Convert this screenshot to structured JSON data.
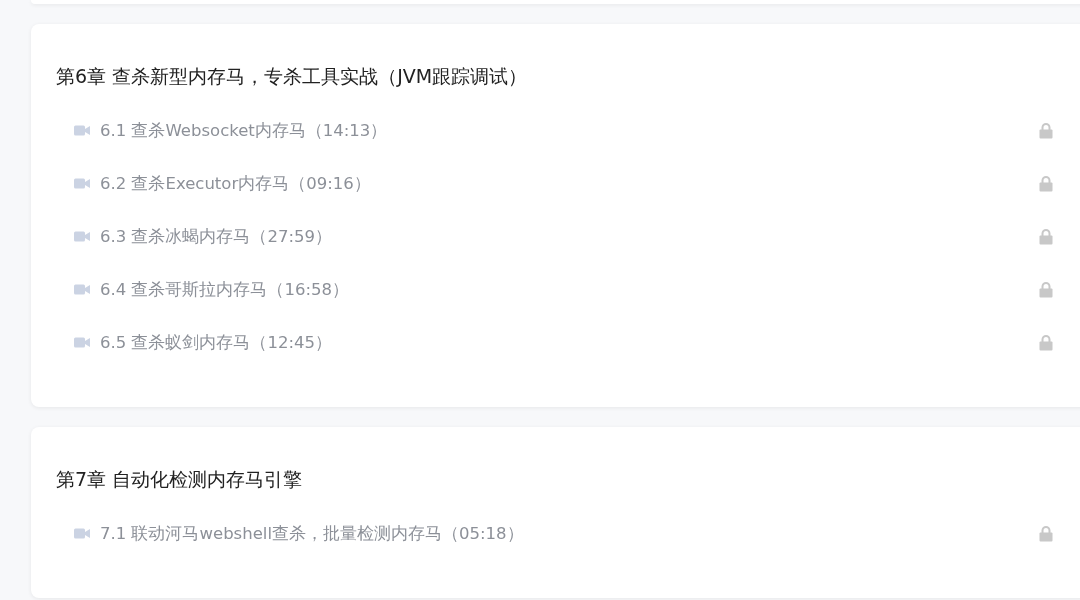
{
  "chapters": [
    {
      "title": "第6章 查杀新型内存马，专杀工具实战（JVM跟踪调试）",
      "lessons": [
        {
          "kind": "video",
          "title": "6.1 查杀Websocket内存马（14:13）",
          "locked": true
        },
        {
          "kind": "video",
          "title": "6.2 查杀Executor内存马（09:16）",
          "locked": true
        },
        {
          "kind": "video",
          "title": "6.3 查杀冰蝎内存马（27:59）",
          "locked": true
        },
        {
          "kind": "video",
          "title": "6.4 查杀哥斯拉内存马（16:58）",
          "locked": true
        },
        {
          "kind": "video",
          "title": "6.5 查杀蚁剑内存马（12:45）",
          "locked": true
        }
      ]
    },
    {
      "title": "第7章 自动化检测内存马引擎",
      "lessons": [
        {
          "kind": "video",
          "title": "7.1 联动河马webshell查杀，批量检测内存马（05:18）",
          "locked": true
        }
      ]
    }
  ]
}
